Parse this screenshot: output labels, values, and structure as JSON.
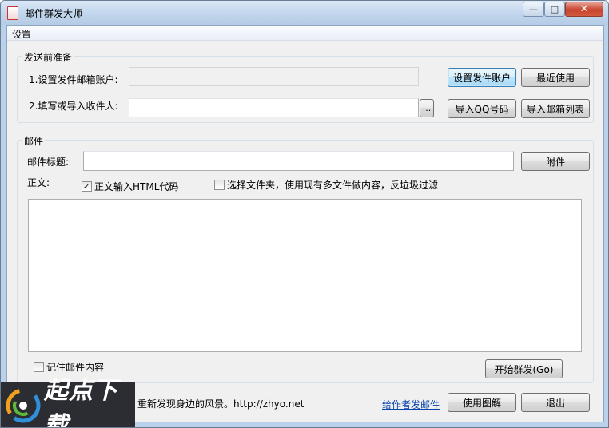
{
  "window": {
    "title": "邮件群发大师"
  },
  "menu": {
    "settings": "设置"
  },
  "prep": {
    "legend": "发送前准备",
    "account_label": "1.设置发件邮箱账户:",
    "account_value": "",
    "set_account_button": "设置发件账户",
    "recent_button": "最近使用",
    "recipients_label": "2.填写或导入收件人:",
    "recipients_value": "",
    "browse_button": "...",
    "import_qq_button": "导入QQ号码",
    "import_list_button": "导入邮箱列表"
  },
  "mail": {
    "legend": "邮件",
    "subject_label": "邮件标题:",
    "subject_value": "",
    "attach_button": "附件",
    "body_label": "正文:",
    "html_check_label": "正文输入HTML代码",
    "html_checked": true,
    "folder_check_label": "选择文件夹，使用现有多文件做内容，反垃圾过滤",
    "folder_checked": false,
    "body_value": "",
    "remember_label": "记住邮件内容",
    "remember_checked": false,
    "start_button": "开始群发(Go)"
  },
  "footer": {
    "slogan": "重新发现身边的风景。http://zhyo.net",
    "mail_author_link": "给作者发邮件",
    "help_button": "使用图解",
    "exit_button": "退出"
  },
  "watermark": {
    "text": "起点下载"
  }
}
